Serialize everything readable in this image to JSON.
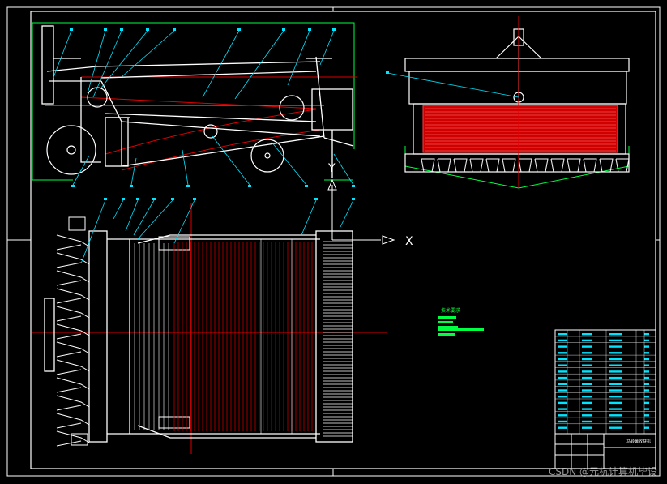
{
  "drawing": {
    "x_axis_label": "X",
    "y_axis_label": "Y",
    "tech_requirements_title": "技术要求",
    "title_block_name": "马铃薯收获机"
  },
  "watermark": "CSDN @元杭计算机毕设",
  "colors": {
    "background": "#000000",
    "frame": "#ffffff",
    "outline": "#ffffff",
    "centerline": "#ff2020",
    "callout": "#00e5ff",
    "section": "#e00000",
    "green": "#00ff40"
  }
}
